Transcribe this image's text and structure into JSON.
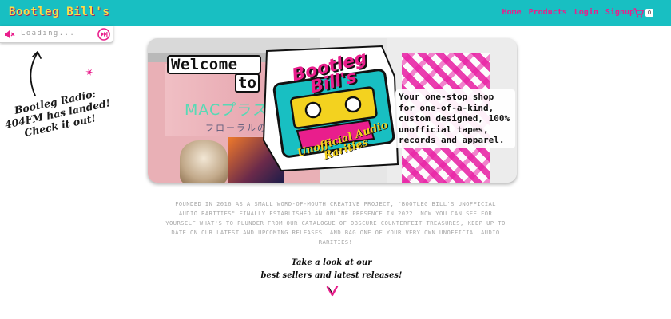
{
  "nav": {
    "brand": "Bootleg Bill's",
    "links": [
      "Home",
      "Products",
      "Login",
      "Signup"
    ],
    "cart_count": "0"
  },
  "radio": {
    "status": "Loading...",
    "mute_icon": "speaker-muted-icon",
    "skip_icon": "skip-forward-icon"
  },
  "note": {
    "line1": "Bootleg Radio:",
    "line2": "404FM has landed!",
    "line3": "Check it out!"
  },
  "hero": {
    "welcome": "Welcome",
    "to": "to",
    "logo_top": "Bootleg Bill's",
    "logo_bottom": "Unofficial Audio Rarities",
    "bg_text_1": "MACプラス",
    "bg_text_2": "フローラルの",
    "tagline": "Your one-stop shop for one-of-a-kind, custom designed, 100% unofficial tapes, records and apparel."
  },
  "intro": "Founded in 2016 as a small word-of-mouth creative project, \"Bootleg Bill's Unofficial Audio Rarities\" finally established an online presence in 2022. Now you can see for yourself what's to plunder from our catalogue of obscure counterfeit treasures, keep up to date on our latest and upcoming releases, and bag one of your very own unofficial audio rarities!",
  "cta": {
    "line1": "Take a look at our",
    "line2": "best sellers and latest releases!"
  },
  "colors": {
    "teal": "#18bfc2",
    "pink": "#e91e8c",
    "yellow": "#f7e04a"
  }
}
